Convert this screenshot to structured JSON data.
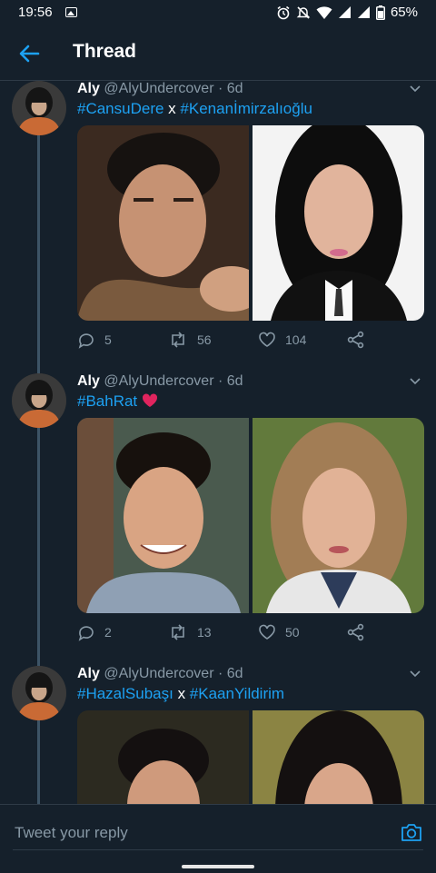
{
  "status_bar": {
    "time": "19:56",
    "battery": "65%"
  },
  "header": {
    "title": "Thread"
  },
  "tweets": [
    {
      "name": "Aly",
      "handle": "@AlyUndercover",
      "time": "· 6d",
      "text": [
        {
          "t": "#CansuDere",
          "tag": true
        },
        {
          "t": " x ",
          "tag": false
        },
        {
          "t": "#Kenanİmirzalıoğlu",
          "tag": true
        }
      ],
      "replies": "5",
      "retweets": "56",
      "likes": "104"
    },
    {
      "name": "Aly",
      "handle": "@AlyUndercover",
      "time": "· 6d",
      "text": [
        {
          "t": "#BahRat",
          "tag": true
        }
      ],
      "emoji": "heart",
      "replies": "2",
      "retweets": "13",
      "likes": "50"
    },
    {
      "name": "Aly",
      "handle": "@AlyUndercover",
      "time": "· 6d",
      "text": [
        {
          "t": "#HazalSubaşı",
          "tag": true
        },
        {
          "t": " x ",
          "tag": false
        },
        {
          "t": "#KaanYildirim",
          "tag": true
        }
      ]
    }
  ],
  "reply_bar": {
    "placeholder": "Tweet your reply"
  },
  "colors": {
    "background": "#15202b",
    "accent": "#1da1f2",
    "muted": "#8899a6",
    "heart": "#e0245e"
  }
}
